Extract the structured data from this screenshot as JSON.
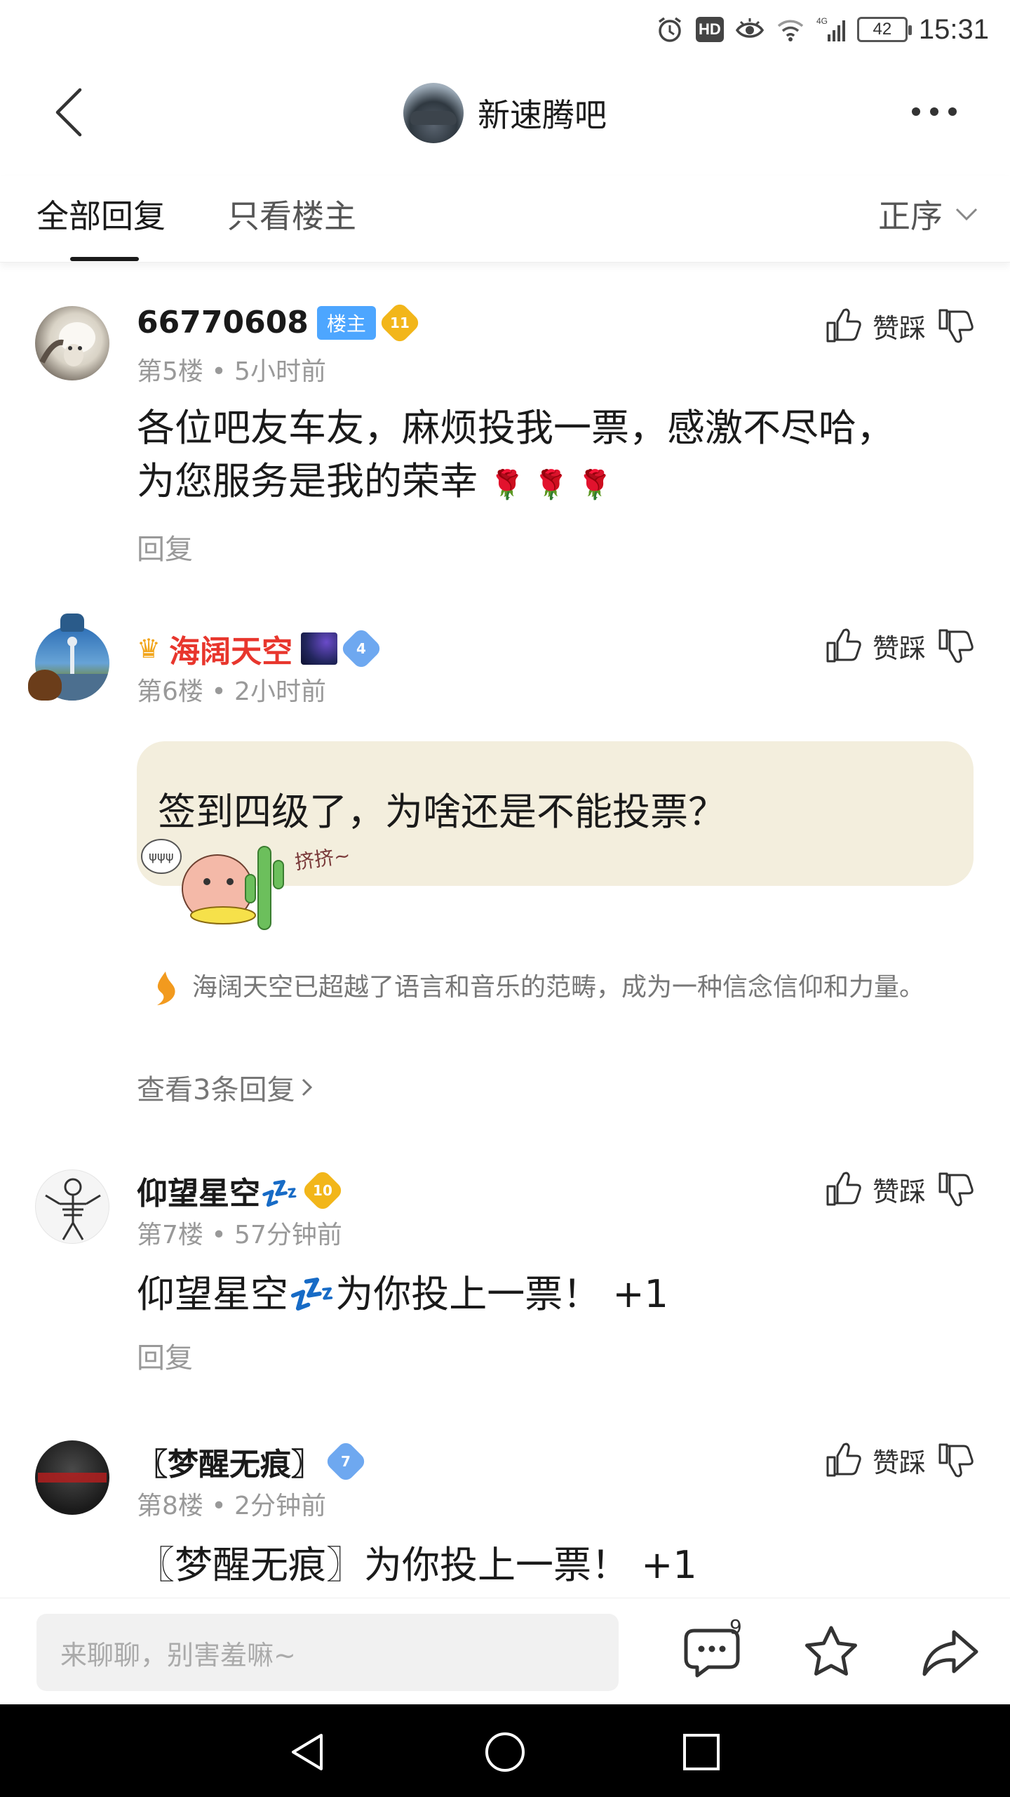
{
  "status_bar": {
    "time": "15:31",
    "battery": "42",
    "hd_label": "HD",
    "icons": [
      "alarm-icon",
      "hd-icon",
      "eye-icon",
      "wifi-icon",
      "signal-4g-icon",
      "battery-icon"
    ]
  },
  "header": {
    "title": "新速腾吧",
    "back_icon": "chevron-left-icon",
    "more_icon": "more-dots-icon"
  },
  "tabs": {
    "all_replies": "全部回复",
    "only_op": "只看楼主",
    "sort_label": "正序",
    "active": "全部回复"
  },
  "vote_label": "赞踩",
  "posts": [
    {
      "username": "66770608",
      "op_badge": "楼主",
      "level": "11",
      "floor": "第5楼",
      "time": "5小时前",
      "line1": "各位吧友车友，麻烦投我一票，感激不尽哈，",
      "line2": "为您服务是我的荣幸",
      "emoji": "🌹 🌹 🌹",
      "reply_label": "回复"
    },
    {
      "username": "海阔天空",
      "level": "4",
      "floor": "第6楼",
      "time": "2小时前",
      "bubble_text": "签到四级了，为啥还是不能投票？",
      "sticker_text": "挤挤~",
      "signature": "海阔天空已超越了语言和音乐的范畴，成为一种信念信仰和力量。",
      "view_replies": "查看3条回复"
    },
    {
      "username": "仰望星空💤",
      "level": "10",
      "floor": "第7楼",
      "time": "57分钟前",
      "text": "仰望星空💤为你投上一票！ +1",
      "reply_label": "回复"
    },
    {
      "username": "〖梦醒无痕〗",
      "level": "7",
      "floor": "第8楼",
      "time": "2分钟前",
      "text": "〖梦醒无痕〗为你投上一票！ +1"
    }
  ],
  "bottom_bar": {
    "input_placeholder": "来聊聊，别害羞嘛~",
    "comment_count": "9",
    "icons": [
      "comment-icon",
      "star-icon",
      "share-icon"
    ]
  },
  "nav_bar": {
    "icons": [
      "nav-back-icon",
      "nav-home-icon",
      "nav-recents-icon"
    ]
  },
  "colors": {
    "vip_name": "#e8362d",
    "op_badge": "#4da6ff",
    "bubble_bg": "#f3eedd",
    "level_gold": "#f2b61a",
    "level_blue": "#6ea8f0"
  }
}
